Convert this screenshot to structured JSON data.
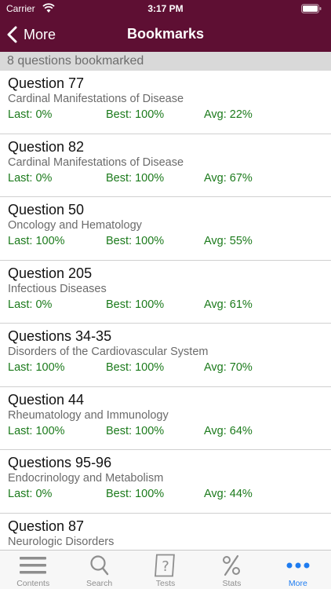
{
  "status_bar": {
    "carrier": "Carrier",
    "time": "3:17 PM"
  },
  "nav": {
    "back_label": "More",
    "title": "Bookmarks"
  },
  "section": {
    "header": "8 questions bookmarked"
  },
  "bookmarks": [
    {
      "title": "Question 77",
      "subtitle": "Cardinal Manifestations of Disease",
      "last": "Last: 0%",
      "best": "Best: 100%",
      "avg": "Avg: 22%"
    },
    {
      "title": "Question 82",
      "subtitle": "Cardinal Manifestations of Disease",
      "last": "Last: 0%",
      "best": "Best: 100%",
      "avg": "Avg: 67%"
    },
    {
      "title": "Question 50",
      "subtitle": "Oncology and Hematology",
      "last": "Last: 100%",
      "best": "Best: 100%",
      "avg": "Avg: 55%"
    },
    {
      "title": "Question 205",
      "subtitle": "Infectious Diseases",
      "last": "Last: 0%",
      "best": "Best: 100%",
      "avg": "Avg: 61%"
    },
    {
      "title": "Questions 34-35",
      "subtitle": "Disorders of the Cardiovascular System",
      "last": "Last: 100%",
      "best": "Best: 100%",
      "avg": "Avg: 70%"
    },
    {
      "title": "Question 44",
      "subtitle": "Rheumatology and Immunology",
      "last": "Last: 100%",
      "best": "Best: 100%",
      "avg": "Avg: 64%"
    },
    {
      "title": "Questions 95-96",
      "subtitle": "Endocrinology and Metabolism",
      "last": "Last: 0%",
      "best": "Best: 100%",
      "avg": "Avg: 44%"
    },
    {
      "title": "Question 87",
      "subtitle": "Neurologic Disorders",
      "last": "",
      "best": "",
      "avg": ""
    }
  ],
  "tabs": [
    {
      "label": "Contents",
      "icon": "list-icon",
      "active": false
    },
    {
      "label": "Search",
      "icon": "search-icon",
      "active": false
    },
    {
      "label": "Tests",
      "icon": "question-mark-icon",
      "active": false
    },
    {
      "label": "Stats",
      "icon": "percent-icon",
      "active": false
    },
    {
      "label": "More",
      "icon": "more-dots-icon",
      "active": true
    }
  ],
  "colors": {
    "header_bg": "#5e0f33",
    "stat_green": "#1b7a1b",
    "tab_active": "#1e7cf0",
    "tab_inactive": "#8e8e8e"
  }
}
